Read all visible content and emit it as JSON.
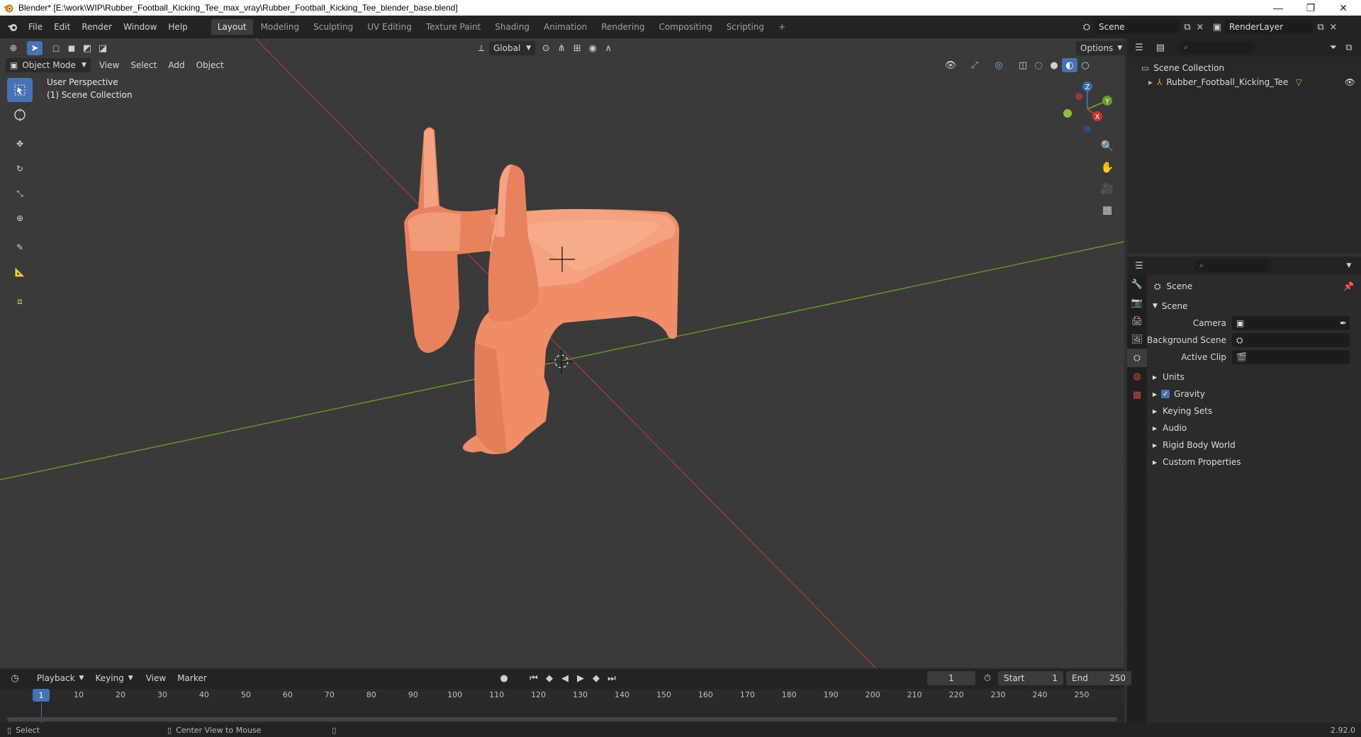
{
  "window": {
    "title": "Blender* [E:\\work\\WIP\\Rubber_Football_Kicking_Tee_max_vray\\Rubber_Football_Kicking_Tee_blender_base.blend]",
    "minimize": "—",
    "restore": "❐",
    "close": "✕"
  },
  "menu": [
    "File",
    "Edit",
    "Render",
    "Window",
    "Help"
  ],
  "workspaces": [
    "Layout",
    "Modeling",
    "Sculpting",
    "UV Editing",
    "Texture Paint",
    "Shading",
    "Animation",
    "Rendering",
    "Compositing",
    "Scripting"
  ],
  "workspace_add": "+",
  "scene_selector": {
    "value": "Scene"
  },
  "render_layer": {
    "value": "RenderLayer"
  },
  "viewport": {
    "mode": "Object Mode",
    "menus": [
      "View",
      "Select",
      "Add",
      "Object"
    ],
    "orientation": "Global",
    "options_label": "Options",
    "perspective_text": "User Perspective",
    "collection_text": "(1) Scene Collection",
    "gizmo": {
      "x": "X",
      "y": "Y",
      "z": "Z"
    }
  },
  "outliner": {
    "search_placeholder": "",
    "root": "Scene Collection",
    "items": [
      "Rubber_Football_Kicking_Tee"
    ]
  },
  "properties": {
    "context_title": "Scene",
    "panel_title": "Scene",
    "camera_label": "Camera",
    "background_scene_label": "Background Scene",
    "active_clip_label": "Active Clip",
    "subpanels": [
      "Units",
      "Gravity",
      "Keying Sets",
      "Audio",
      "Rigid Body World",
      "Custom Properties"
    ],
    "gravity_checked": true
  },
  "timeline": {
    "menus": [
      "Playback",
      "Keying",
      "View",
      "Marker"
    ],
    "current_frame": "1",
    "start_label": "Start",
    "start_value": "1",
    "end_label": "End",
    "end_value": "250",
    "ticks": [
      "1",
      "10",
      "20",
      "30",
      "40",
      "50",
      "60",
      "70",
      "80",
      "90",
      "100",
      "110",
      "120",
      "130",
      "140",
      "150",
      "160",
      "170",
      "180",
      "190",
      "200",
      "210",
      "220",
      "230",
      "240",
      "250"
    ]
  },
  "statusbar": {
    "left": "Select",
    "middle": "Center View to Mouse",
    "version": "2.92.0"
  },
  "colors": {
    "accent": "#4772b3",
    "object": "#f0906c",
    "axis_x": "#a03a3a",
    "axis_y": "#6a9a2a"
  }
}
